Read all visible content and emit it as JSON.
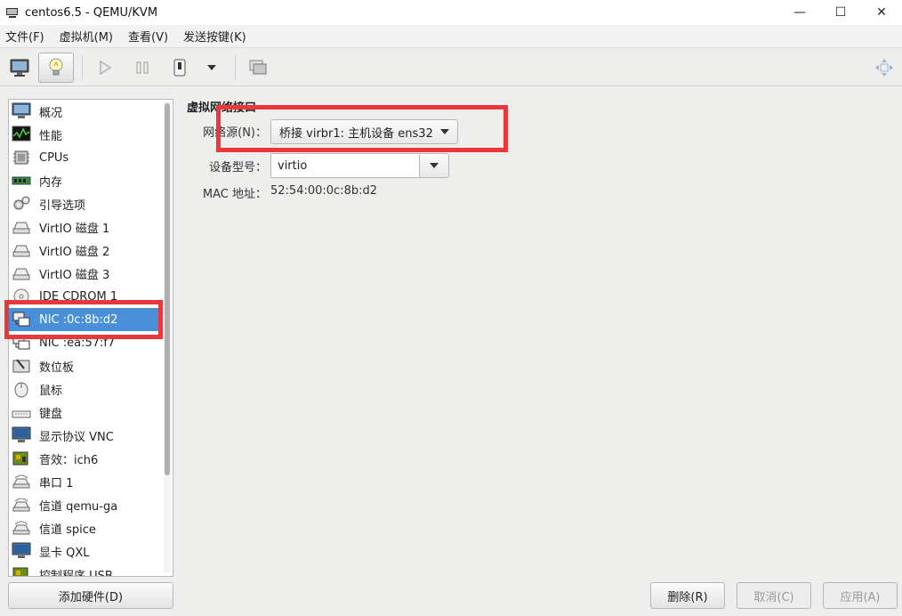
{
  "window": {
    "title": "centos6.5 - QEMU/KVM",
    "controls": {
      "minimize": "—",
      "maximize": "☐",
      "close": "✕"
    }
  },
  "menu": {
    "items": [
      "文件(F)",
      "虚拟机(M)",
      "查看(V)",
      "发送按键(K)"
    ]
  },
  "toolbar": {
    "buttons": [
      "console-monitor-icon",
      "details-lightbulb-icon",
      "run-play-icon",
      "pause-icon",
      "shutdown-power-icon",
      "shutdown-menu-arrow-icon",
      "snapshots-icon"
    ],
    "right_icon": "move-arrows-icon"
  },
  "sidebar": {
    "items": [
      {
        "label": "概况",
        "icon": "overview-monitor-icon"
      },
      {
        "label": "性能",
        "icon": "performance-graph-icon"
      },
      {
        "label": "CPUs",
        "icon": "cpu-chip-icon"
      },
      {
        "label": "内存",
        "icon": "memory-ram-icon"
      },
      {
        "label": "引导选项",
        "icon": "boot-gears-icon"
      },
      {
        "label": "VirtIO 磁盘 1",
        "icon": "disk-drive-icon"
      },
      {
        "label": "VirtIO 磁盘 2",
        "icon": "disk-drive-icon"
      },
      {
        "label": "VirtIO 磁盘 3",
        "icon": "disk-drive-icon"
      },
      {
        "label": "IDE CDROM 1",
        "icon": "cdrom-icon"
      },
      {
        "label": "NIC :0c:8b:d2",
        "icon": "network-nic-icon",
        "selected": true
      },
      {
        "label": "NIC :ea:57:f7",
        "icon": "network-nic-icon"
      },
      {
        "label": "数位板",
        "icon": "tablet-icon"
      },
      {
        "label": "鼠标",
        "icon": "mouse-icon"
      },
      {
        "label": "键盘",
        "icon": "keyboard-icon"
      },
      {
        "label": "显示协议 VNC",
        "icon": "display-monitor-icon"
      },
      {
        "label": "音效：ich6",
        "icon": "sound-card-icon"
      },
      {
        "label": "串口 1",
        "icon": "serial-port-icon"
      },
      {
        "label": "信道 qemu-ga",
        "icon": "channel-icon"
      },
      {
        "label": "信道 spice",
        "icon": "channel-icon"
      },
      {
        "label": "显卡 QXL",
        "icon": "video-card-icon"
      },
      {
        "label": "控制程序 USB",
        "icon": "controller-icon"
      }
    ],
    "add_hardware_button": "添加硬件(D)"
  },
  "detail": {
    "section_title": "虚拟网络接口",
    "network_source_label": "网络源(N)：",
    "network_source_value": "桥接 virbr1: 主机设备 ens32",
    "device_model_label": "设备型号：",
    "device_model_value": "virtio",
    "mac_label": "MAC 地址：",
    "mac_value": "52:54:00:0c:8b:d2"
  },
  "actions": {
    "remove": "删除(R)",
    "cancel": "取消(C)",
    "apply": "应用(A)"
  },
  "colors": {
    "selection": "#4a90d9",
    "highlight_box": "#e8383b"
  }
}
